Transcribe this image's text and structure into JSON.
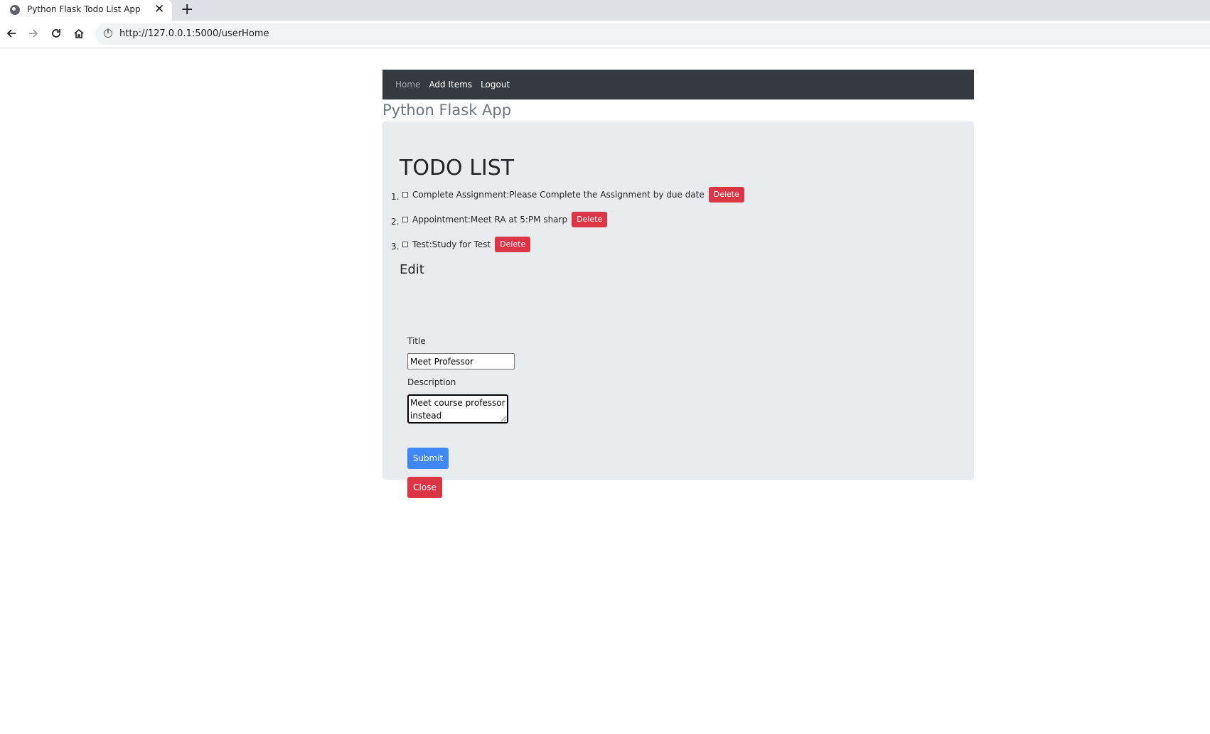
{
  "browser": {
    "tab_title": "Python Flask Todo List App",
    "url": "http://127.0.0.1:5000/userHome"
  },
  "navbar": {
    "home": "Home",
    "add_items": "Add Items",
    "logout": "Logout"
  },
  "app_title": "Python Flask App",
  "todo": {
    "heading": "TODO LIST",
    "items": [
      {
        "num": "1.",
        "text": "Complete Assignment:Please Complete the Assignment by due date",
        "delete_label": "Delete"
      },
      {
        "num": "2.",
        "text": "Appointment:Meet RA at 5:PM sharp",
        "delete_label": "Delete"
      },
      {
        "num": "3.",
        "text": "Test:Study for Test",
        "delete_label": "Delete"
      }
    ]
  },
  "edit": {
    "heading": "Edit",
    "title_label": "Title",
    "title_value": "Meet Professor",
    "description_label": "Description",
    "description_value": "Meet course professor instead",
    "submit_label": "Submit",
    "close_label": "Close"
  },
  "colors": {
    "navbar_bg": "#343a40",
    "jumbotron_bg": "#e9ecef",
    "danger": "#dc3545",
    "primary": "#3f87f5"
  }
}
